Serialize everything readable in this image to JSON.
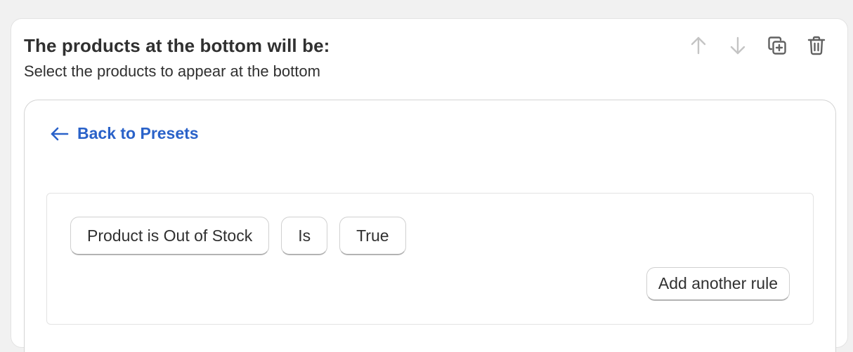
{
  "section": {
    "title": "The products at the bottom will be:",
    "subtitle": "Select the products to appear at the bottom"
  },
  "toolbar": {
    "icons": [
      "arrow-up-icon",
      "arrow-down-icon",
      "duplicate-icon",
      "trash-icon"
    ],
    "disabled_color": "#c4c4c4",
    "enabled_color": "#616161"
  },
  "preset": {
    "back_label": "Back to Presets",
    "link_color": "#2a62c9"
  },
  "rules": {
    "conditions": [
      {
        "field": "Product is Out of Stock",
        "operator": "Is",
        "value": "True"
      }
    ],
    "add_rule_label": "Add another rule"
  }
}
